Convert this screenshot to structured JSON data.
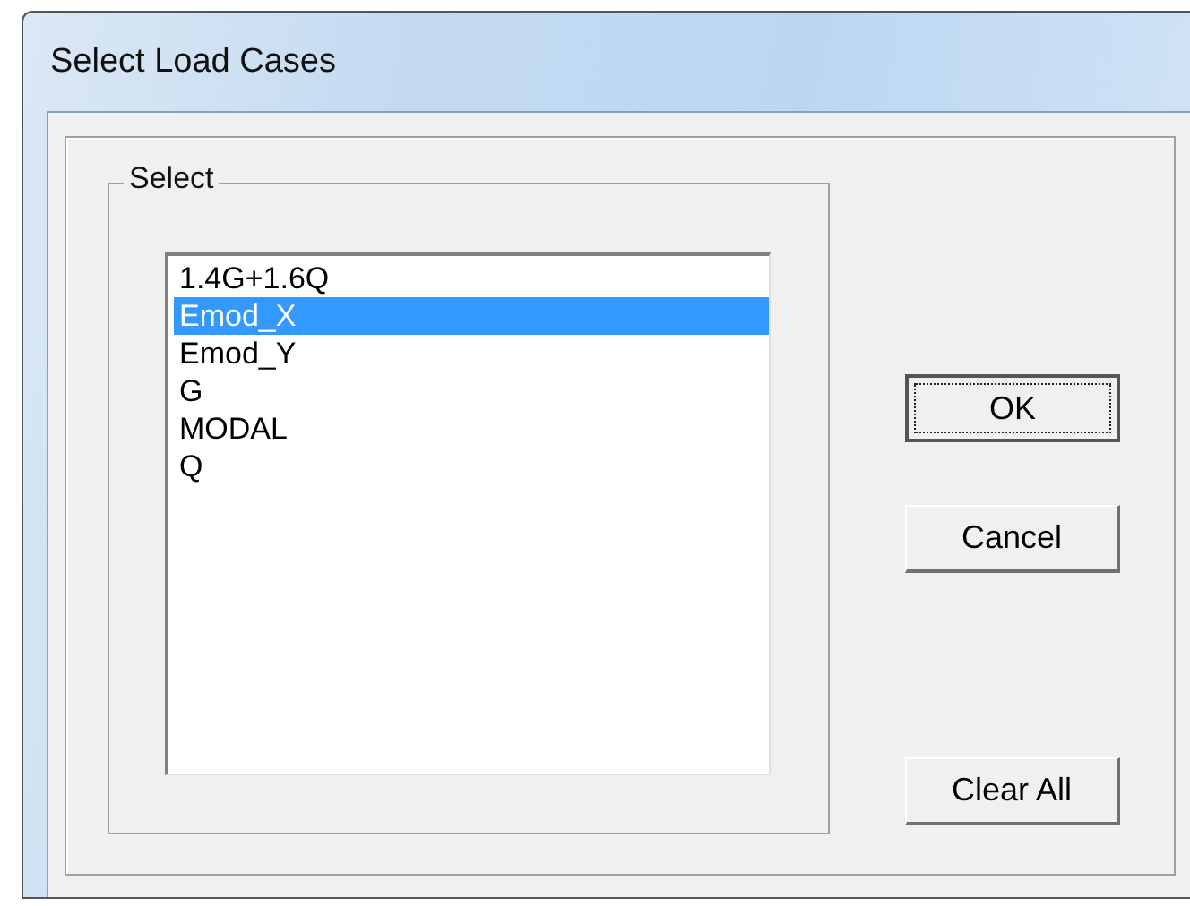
{
  "window": {
    "title": "Select Load Cases"
  },
  "group": {
    "label": "Select"
  },
  "list": [
    {
      "label": "1.4G+1.6Q",
      "selected": false
    },
    {
      "label": "Emod_X",
      "selected": true
    },
    {
      "label": "Emod_Y",
      "selected": false
    },
    {
      "label": "G",
      "selected": false
    },
    {
      "label": "MODAL",
      "selected": false
    },
    {
      "label": "Q",
      "selected": false
    }
  ],
  "buttons": [
    {
      "label": "OK",
      "focused": true
    },
    {
      "label": "Cancel",
      "focused": false
    },
    {
      "label": "Clear All",
      "focused": false
    }
  ]
}
